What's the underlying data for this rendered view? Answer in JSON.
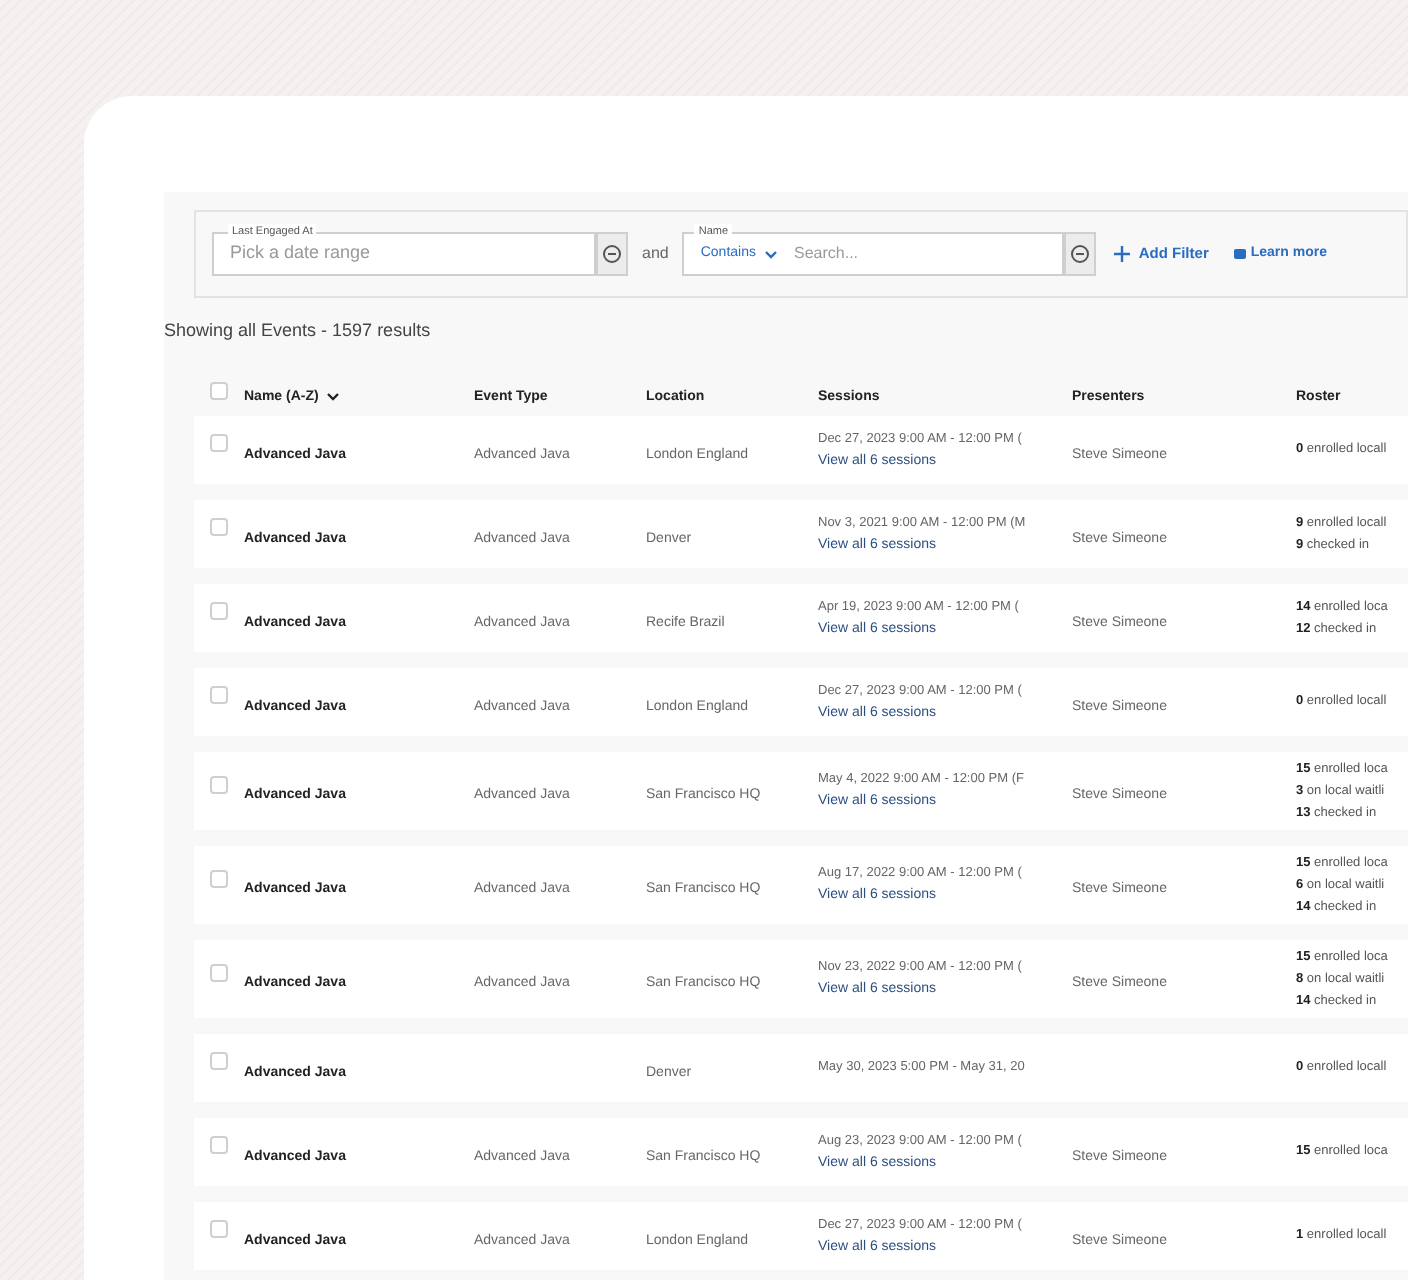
{
  "filters": [
    {
      "kind": "date",
      "label": "Last Engaged At",
      "placeholder": "Pick a date range"
    },
    {
      "kind": "text",
      "label": "Name",
      "operator": "Contains",
      "placeholder": "Search..."
    }
  ],
  "joiner": "and",
  "add_filter": "Add Filter",
  "learn_more": "Learn more",
  "summary": "Showing all Events - 1597 results",
  "select_all_checked": false,
  "columns": [
    "Name (A-Z)",
    "Event Type",
    "Location",
    "Sessions",
    "Presenters",
    "Roster"
  ],
  "rows": [
    {
      "checked": false,
      "name": "Advanced Java",
      "event_type": "Advanced Java",
      "location": "London England",
      "session": "Dec 27, 2023 9:00 AM - 12:00 PM (",
      "sessions_link": "View all 6 sessions",
      "presenter": "Steve Simeone",
      "roster": [
        "**0** enrolled locall"
      ]
    },
    {
      "checked": false,
      "name": "Advanced Java",
      "event_type": "Advanced Java",
      "location": "Denver",
      "session": "Nov 3, 2021 9:00 AM - 12:00 PM (M",
      "sessions_link": "View all 6 sessions",
      "presenter": "Steve Simeone",
      "roster": [
        "**9** enrolled locall",
        "**9** checked in"
      ]
    },
    {
      "checked": false,
      "name": "Advanced Java",
      "event_type": "Advanced Java",
      "location": "Recife Brazil",
      "session": "Apr 19, 2023 9:00 AM - 12:00 PM (",
      "sessions_link": "View all 6 sessions",
      "presenter": "Steve Simeone",
      "roster": [
        "**14** enrolled loca",
        "**12** checked in"
      ]
    },
    {
      "checked": false,
      "name": "Advanced Java",
      "event_type": "Advanced Java",
      "location": "London England",
      "session": "Dec 27, 2023 9:00 AM - 12:00 PM (",
      "sessions_link": "View all 6 sessions",
      "presenter": "Steve Simeone",
      "roster": [
        "**0** enrolled locall"
      ]
    },
    {
      "checked": false,
      "name": "Advanced Java",
      "event_type": "Advanced Java",
      "location": "San Francisco HQ",
      "session": "May 4, 2022 9:00 AM - 12:00 PM (F",
      "sessions_link": "View all 6 sessions",
      "presenter": "Steve Simeone",
      "roster": [
        "**15** enrolled loca",
        "**3** on local waitli",
        "**13** checked in"
      ]
    },
    {
      "checked": false,
      "name": "Advanced Java",
      "event_type": "Advanced Java",
      "location": "San Francisco HQ",
      "session": "Aug 17, 2022 9:00 AM - 12:00 PM (",
      "sessions_link": "View all 6 sessions",
      "presenter": "Steve Simeone",
      "roster": [
        "**15** enrolled loca",
        "**6** on local waitli",
        "**14** checked in"
      ]
    },
    {
      "checked": false,
      "name": "Advanced Java",
      "event_type": "Advanced Java",
      "location": "San Francisco HQ",
      "session": "Nov 23, 2022 9:00 AM - 12:00 PM (",
      "sessions_link": "View all 6 sessions",
      "presenter": "Steve Simeone",
      "roster": [
        "**15** enrolled loca",
        "**8** on local waitli",
        "**14** checked in"
      ]
    },
    {
      "checked": false,
      "name": "Advanced Java",
      "location": "Denver",
      "session": "May 30, 2023 5:00 PM - May 31, 20",
      "roster": [
        "**0** enrolled locall"
      ]
    },
    {
      "checked": false,
      "name": "Advanced Java",
      "event_type": "Advanced Java",
      "location": "San Francisco HQ",
      "session": "Aug 23, 2023 9:00 AM - 12:00 PM (",
      "sessions_link": "View all 6 sessions",
      "presenter": "Steve Simeone",
      "roster": [
        "**15** enrolled loca"
      ]
    },
    {
      "checked": false,
      "name": "Advanced Java",
      "event_type": "Advanced Java",
      "location": "London England",
      "session": "Dec 27, 2023 9:00 AM - 12:00 PM (",
      "sessions_link": "View all 6 sessions",
      "presenter": "Steve Simeone",
      "roster": [
        "**1** enrolled locall"
      ]
    }
  ]
}
